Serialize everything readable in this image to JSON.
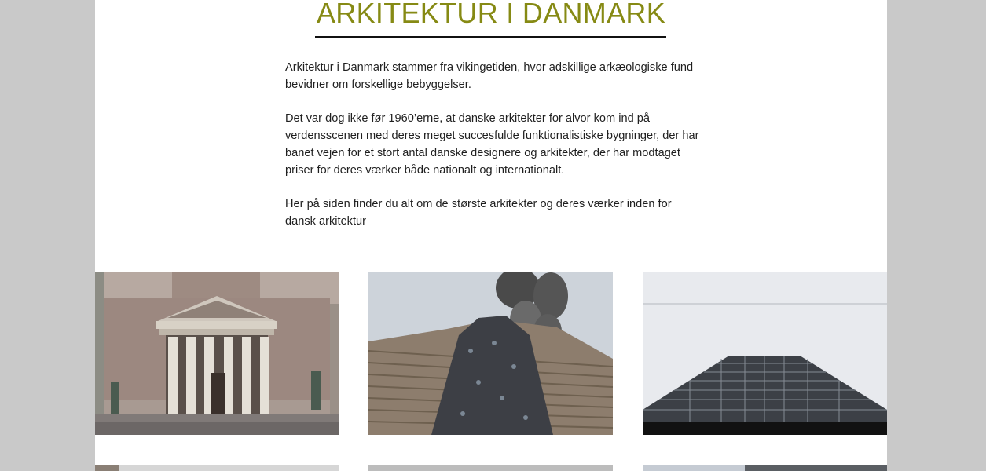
{
  "page": {
    "title": "ARKITEKTUR I DANMARK",
    "paragraphs": [
      "Arkitektur i Danmark stammer fra vikingetiden, hvor adskillige arkæologiske fund bevidner om forskellige bebyggelser.",
      "Det var dog ikke før 1960’erne, at danske arkitekter for alvor kom ind på verdensscenen med deres meget succesfulde funktionalistiske bygninger, der har banet vejen for et stort antal danske designere og arkitekter, der har modtaget priser for deres værker både nationalt og internationalt.",
      "Her på siden finder du alt om de største arkitekter og deres værker inden for dansk arkitektur"
    ]
  },
  "colors": {
    "title": "#868a14",
    "background": "#c9c9c9",
    "content": "#ffffff"
  },
  "gallery": {
    "photos": [
      "church-photo",
      "climbing-wall-tower-photo",
      "skyscraper-photo"
    ],
    "partially_visible_row": [
      "gallery-photo",
      "gallery-photo",
      "gallery-photo"
    ]
  }
}
